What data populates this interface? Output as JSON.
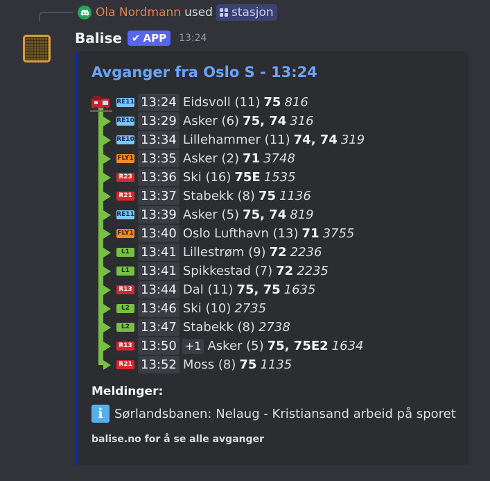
{
  "command": {
    "user": "Ola Nordmann",
    "used_text": "used",
    "command_name": "stasjon"
  },
  "header": {
    "bot_name": "Balise",
    "badge": "APP",
    "timestamp": "13:24"
  },
  "embed": {
    "title": "Avganger fra Oslo S - 13:24",
    "accent_color": "#0b2bac",
    "departures": [
      {
        "line": "RE11",
        "line_type": "re",
        "time": "13:24",
        "destination": "Eidsvoll (11)",
        "tracks": "75",
        "number": "816"
      },
      {
        "line": "RE10",
        "line_type": "re",
        "time": "13:29",
        "destination": "Asker (6)",
        "tracks": "75, 74",
        "number": "316"
      },
      {
        "line": "RE10",
        "line_type": "re",
        "time": "13:34",
        "destination": "Lillehammer (11)",
        "tracks": "74, 74",
        "number": "319"
      },
      {
        "line": "FLY1",
        "line_type": "fly",
        "time": "13:35",
        "destination": "Asker (2)",
        "tracks": "71",
        "number": "3748"
      },
      {
        "line": "R23",
        "line_type": "r",
        "time": "13:36",
        "destination": "Ski (16)",
        "tracks": "75E",
        "number": "1535"
      },
      {
        "line": "R21",
        "line_type": "r",
        "time": "13:37",
        "destination": "Stabekk (8)",
        "tracks": "75",
        "number": "1136"
      },
      {
        "line": "RE11",
        "line_type": "re",
        "time": "13:39",
        "destination": "Asker (5)",
        "tracks": "75, 74",
        "number": "819"
      },
      {
        "line": "FLY1",
        "line_type": "fly",
        "time": "13:40",
        "destination": "Oslo Lufthavn (13)",
        "tracks": "71",
        "number": "3755"
      },
      {
        "line": "L1",
        "line_type": "l",
        "time": "13:41",
        "destination": "Lillestrøm (9)",
        "tracks": "72",
        "number": "2236"
      },
      {
        "line": "L1",
        "line_type": "l",
        "time": "13:41",
        "destination": "Spikkestad (7)",
        "tracks": "72",
        "number": "2235"
      },
      {
        "line": "R13",
        "line_type": "r",
        "time": "13:44",
        "destination": "Dal (11)",
        "tracks": "75, 75",
        "number": "1635"
      },
      {
        "line": "L2",
        "line_type": "l",
        "time": "13:46",
        "destination": "Ski (10)",
        "tracks": "",
        "number": "2735"
      },
      {
        "line": "L2",
        "line_type": "l",
        "time": "13:47",
        "destination": "Stabekk (8)",
        "tracks": "",
        "number": "2738"
      },
      {
        "line": "R13",
        "line_type": "r",
        "time": "13:50",
        "delay": "+1",
        "destination": "Asker (5)",
        "tracks": "75, 75E2",
        "number": "1634"
      },
      {
        "line": "R21",
        "line_type": "r",
        "time": "13:52",
        "destination": "Moss (8)",
        "tracks": "75",
        "number": "1135"
      }
    ],
    "messages_heading": "Meldinger:",
    "message_icon": "i",
    "message": "Sørlandsbanen: Nelaug - Kristiansand arbeid på sporet",
    "footer": "balise.no for å se alle avganger"
  },
  "colors": {
    "background": "#313338",
    "embed_background": "#2b2d31",
    "title_link": "#6ba4f8",
    "line_green": "#77c043",
    "app_badge": "#5865f2"
  }
}
